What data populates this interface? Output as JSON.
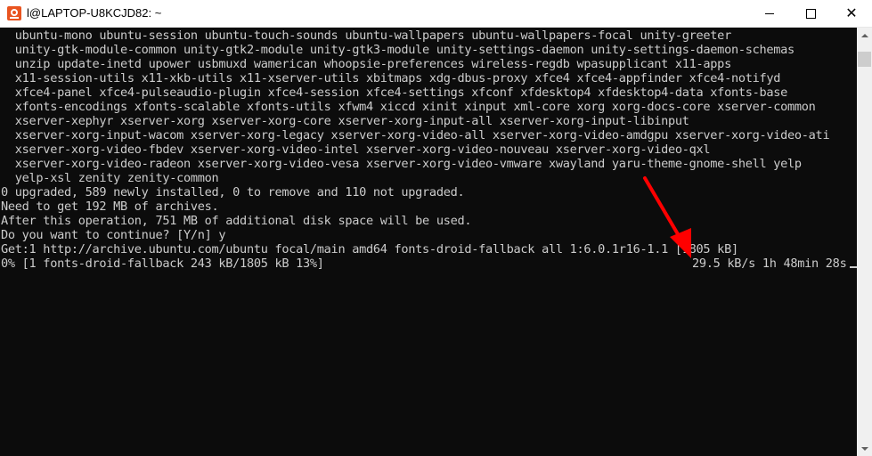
{
  "window": {
    "title": "l@LAPTOP-U8KCJD82: ~",
    "app_icon": "ubuntu-terminal-icon",
    "controls": [
      "minimize-icon",
      "maximize-icon",
      "close-icon"
    ]
  },
  "terminal": {
    "lines": [
      "  ubuntu-mono ubuntu-session ubuntu-touch-sounds ubuntu-wallpapers ubuntu-wallpapers-focal unity-greeter",
      "  unity-gtk-module-common unity-gtk2-module unity-gtk3-module unity-settings-daemon unity-settings-daemon-schemas",
      "  unzip update-inetd upower usbmuxd wamerican whoopsie-preferences wireless-regdb wpasupplicant x11-apps",
      "  x11-session-utils x11-xkb-utils x11-xserver-utils xbitmaps xdg-dbus-proxy xfce4 xfce4-appfinder xfce4-notifyd",
      "  xfce4-panel xfce4-pulseaudio-plugin xfce4-session xfce4-settings xfconf xfdesktop4 xfdesktop4-data xfonts-base",
      "  xfonts-encodings xfonts-scalable xfonts-utils xfwm4 xiccd xinit xinput xml-core xorg xorg-docs-core xserver-common",
      "  xserver-xephyr xserver-xorg xserver-xorg-core xserver-xorg-input-all xserver-xorg-input-libinput",
      "  xserver-xorg-input-wacom xserver-xorg-legacy xserver-xorg-video-all xserver-xorg-video-amdgpu xserver-xorg-video-ati",
      "  xserver-xorg-video-fbdev xserver-xorg-video-intel xserver-xorg-video-nouveau xserver-xorg-video-qxl",
      "  xserver-xorg-video-radeon xserver-xorg-video-vesa xserver-xorg-video-vmware xwayland yaru-theme-gnome-shell yelp",
      "  yelp-xsl zenity zenity-common",
      "0 upgraded, 589 newly installed, 0 to remove and 110 not upgraded.",
      "Need to get 192 MB of archives.",
      "After this operation, 751 MB of additional disk space will be used.",
      "Do you want to continue? [Y/n] y",
      "Get:1 http://archive.ubuntu.com/ubuntu focal/main amd64 fonts-droid-fallback all 1:6.0.1r16-1.1 [1805 kB]"
    ],
    "progress_line": "0% [1 fonts-droid-fallback 243 kB/1805 kB 13%]",
    "progress_status": "29.5 kB/s 1h 48min 28s"
  },
  "colors": {
    "background": "#0c0c0c",
    "text": "#cccccc",
    "annotation_arrow": "#ff0000"
  }
}
